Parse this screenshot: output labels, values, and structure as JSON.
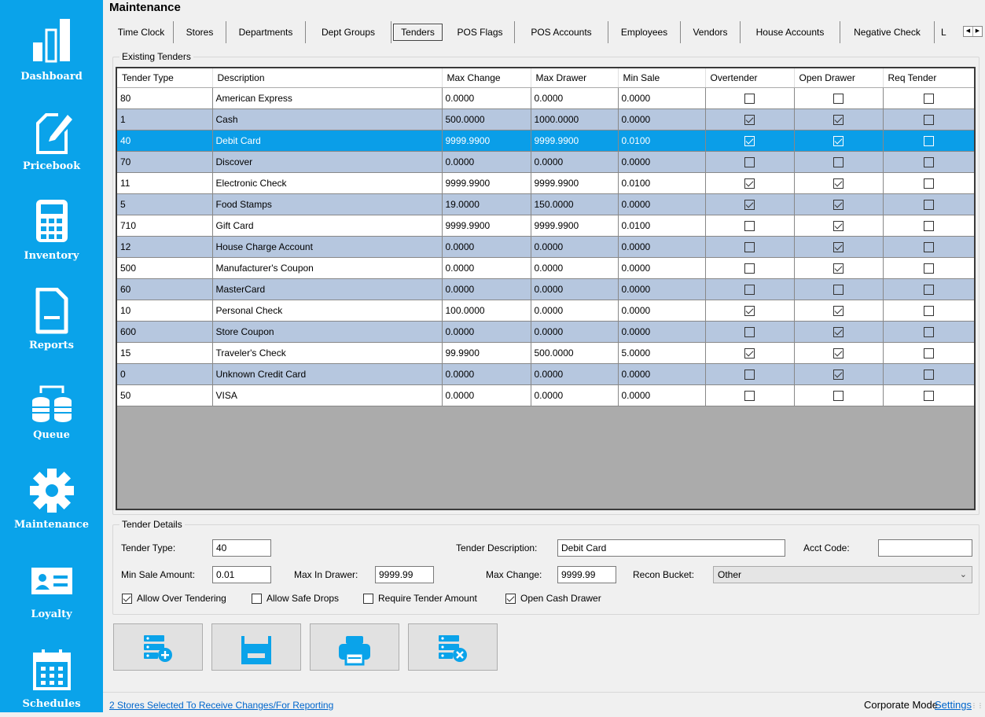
{
  "colors": {
    "sidebar": "#0aa3ea",
    "selected_row": "#0a9ee8",
    "alt_row": "#b6c7df",
    "link": "#0066cc"
  },
  "sidebar": {
    "items": [
      {
        "label": "Dashboard",
        "icon": "bar-chart-icon"
      },
      {
        "label": "Pricebook",
        "icon": "edit-document-icon"
      },
      {
        "label": "Inventory",
        "icon": "calculator-icon"
      },
      {
        "label": "Reports",
        "icon": "report-document-icon"
      },
      {
        "label": "Queue",
        "icon": "database-sync-icon"
      },
      {
        "label": "Maintenance",
        "icon": "gear-icon"
      },
      {
        "label": "Loyalty",
        "icon": "id-card-icon"
      },
      {
        "label": "Schedules",
        "icon": "calendar-icon"
      }
    ]
  },
  "page": {
    "title": "Maintenance"
  },
  "tabs": [
    "Time Clock",
    "Stores",
    "Departments",
    "Dept Groups",
    "Tenders",
    "POS Flags",
    "POS Accounts",
    "Employees",
    "Vendors",
    "House Accounts",
    "Negative Check",
    "L"
  ],
  "active_tab": "Tenders",
  "existing": {
    "group_title": "Existing Tenders",
    "columns": [
      "Tender Type",
      "Description",
      "Max Change",
      "Max Drawer",
      "Min Sale",
      "Overtender",
      "Open Drawer",
      "Req Tender"
    ],
    "rows": [
      {
        "type": "80",
        "desc": "American Express",
        "max_change": "0.0000",
        "max_drawer": "0.0000",
        "min_sale": "0.0000",
        "over": false,
        "open": false,
        "req": false
      },
      {
        "type": "1",
        "desc": "Cash",
        "max_change": "500.0000",
        "max_drawer": "1000.0000",
        "min_sale": "0.0000",
        "over": true,
        "open": true,
        "req": false
      },
      {
        "type": "40",
        "desc": "Debit Card",
        "max_change": "9999.9900",
        "max_drawer": "9999.9900",
        "min_sale": "0.0100",
        "over": true,
        "open": true,
        "req": false,
        "selected": true
      },
      {
        "type": "70",
        "desc": "Discover",
        "max_change": "0.0000",
        "max_drawer": "0.0000",
        "min_sale": "0.0000",
        "over": false,
        "open": false,
        "req": false
      },
      {
        "type": "11",
        "desc": "Electronic Check",
        "max_change": "9999.9900",
        "max_drawer": "9999.9900",
        "min_sale": "0.0100",
        "over": true,
        "open": true,
        "req": false
      },
      {
        "type": "5",
        "desc": "Food Stamps",
        "max_change": "19.0000",
        "max_drawer": "150.0000",
        "min_sale": "0.0000",
        "over": true,
        "open": true,
        "req": false
      },
      {
        "type": "710",
        "desc": "Gift Card",
        "max_change": "9999.9900",
        "max_drawer": "9999.9900",
        "min_sale": "0.0100",
        "over": false,
        "open": true,
        "req": false
      },
      {
        "type": "12",
        "desc": "House Charge Account",
        "max_change": "0.0000",
        "max_drawer": "0.0000",
        "min_sale": "0.0000",
        "over": false,
        "open": true,
        "req": false
      },
      {
        "type": "500",
        "desc": "Manufacturer's Coupon",
        "max_change": "0.0000",
        "max_drawer": "0.0000",
        "min_sale": "0.0000",
        "over": false,
        "open": true,
        "req": false
      },
      {
        "type": "60",
        "desc": "MasterCard",
        "max_change": "0.0000",
        "max_drawer": "0.0000",
        "min_sale": "0.0000",
        "over": false,
        "open": false,
        "req": false
      },
      {
        "type": "10",
        "desc": "Personal Check",
        "max_change": "100.0000",
        "max_drawer": "0.0000",
        "min_sale": "0.0000",
        "over": true,
        "open": true,
        "req": false
      },
      {
        "type": "600",
        "desc": "Store Coupon",
        "max_change": "0.0000",
        "max_drawer": "0.0000",
        "min_sale": "0.0000",
        "over": false,
        "open": true,
        "req": false
      },
      {
        "type": "15",
        "desc": "Traveler's Check",
        "max_change": "99.9900",
        "max_drawer": "500.0000",
        "min_sale": "5.0000",
        "over": true,
        "open": true,
        "req": false
      },
      {
        "type": "0",
        "desc": "Unknown Credit Card",
        "max_change": "0.0000",
        "max_drawer": "0.0000",
        "min_sale": "0.0000",
        "over": false,
        "open": true,
        "req": false
      },
      {
        "type": "50",
        "desc": "VISA",
        "max_change": "0.0000",
        "max_drawer": "0.0000",
        "min_sale": "0.0000",
        "over": false,
        "open": false,
        "req": false
      }
    ]
  },
  "details": {
    "group_title": "Tender Details",
    "tender_type_label": "Tender Type:",
    "tender_type": "40",
    "tender_desc_label": "Tender Description:",
    "tender_desc": "Debit Card",
    "acct_code_label": "Acct Code:",
    "acct_code": "",
    "min_sale_label": "Min Sale Amount:",
    "min_sale": "0.01",
    "max_drawer_label": "Max In Drawer:",
    "max_drawer": "9999.99",
    "max_change_label": "Max Change:",
    "max_change": "9999.99",
    "recon_label": "Recon Bucket:",
    "recon": "Other",
    "checks": [
      {
        "label": "Allow Over Tendering",
        "checked": true
      },
      {
        "label": "Allow Safe Drops",
        "checked": false
      },
      {
        "label": "Require Tender Amount",
        "checked": false
      },
      {
        "label": "Open Cash Drawer",
        "checked": true
      }
    ]
  },
  "actions": [
    {
      "name": "add-tender-button",
      "icon": "database-add-icon"
    },
    {
      "name": "save-button",
      "icon": "floppy-save-icon"
    },
    {
      "name": "print-button",
      "icon": "printer-icon"
    },
    {
      "name": "delete-tender-button",
      "icon": "database-remove-icon"
    }
  ],
  "status": {
    "stores_link": "2 Stores Selected To Receive Changes/For Reporting",
    "mode": "Corporate Mode",
    "settings": "Settings"
  }
}
